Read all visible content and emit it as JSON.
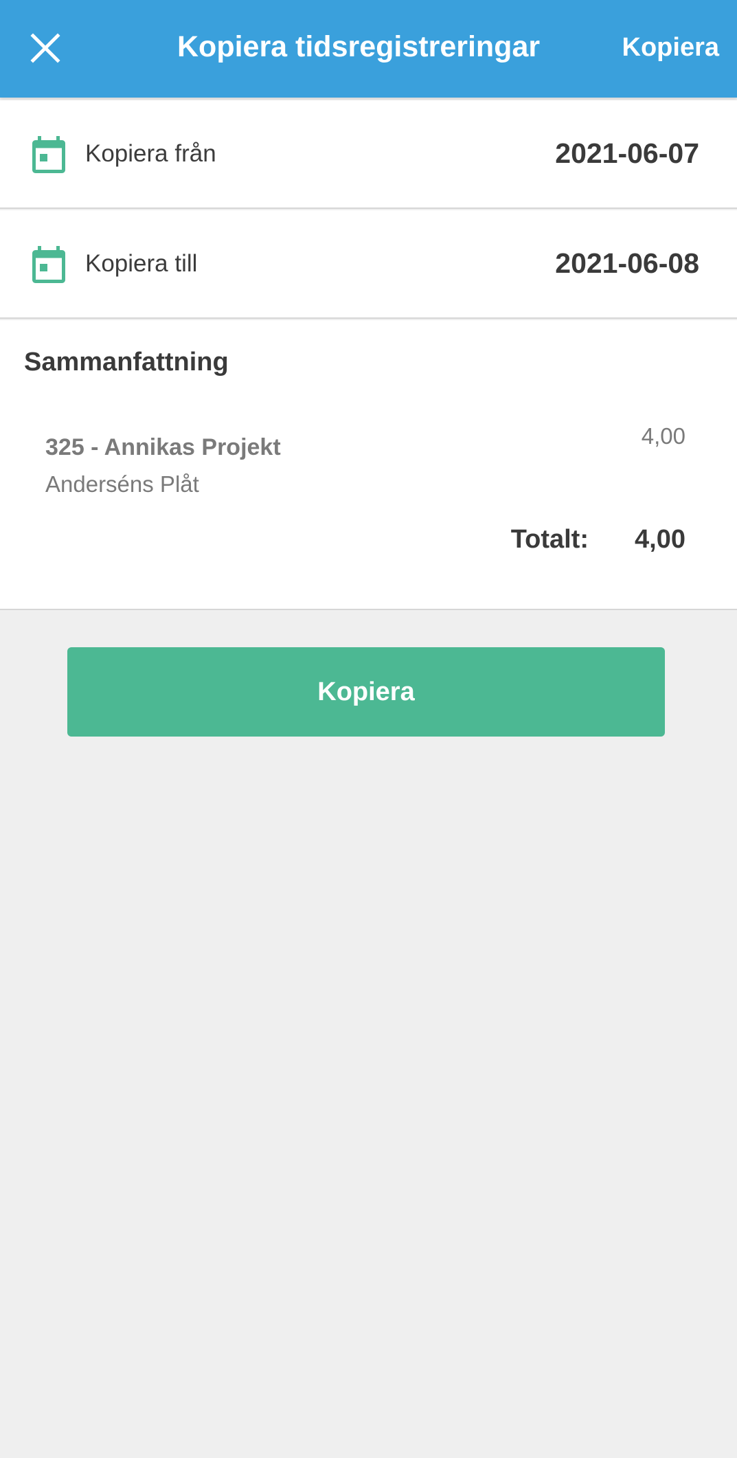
{
  "colors": {
    "header_bg": "#3aa0dc",
    "accent_green": "#4cb893",
    "page_bg": "#efefef"
  },
  "header": {
    "close_icon": "close-icon",
    "title": "Kopiera tidsregistreringar",
    "action_label": "Kopiera"
  },
  "copy_from": {
    "icon": "calendar-icon",
    "label": "Kopiera från",
    "date": "2021-06-07"
  },
  "copy_to": {
    "icon": "calendar-icon",
    "label": "Kopiera till",
    "date": "2021-06-08"
  },
  "summary": {
    "title": "Sammanfattning",
    "items": [
      {
        "project": "325 - Annikas Projekt",
        "customer": "Anderséns Plåt",
        "hours": "4,00"
      }
    ],
    "total_label": "Totalt:",
    "total_value": "4,00"
  },
  "primary_button": {
    "label": "Kopiera"
  }
}
